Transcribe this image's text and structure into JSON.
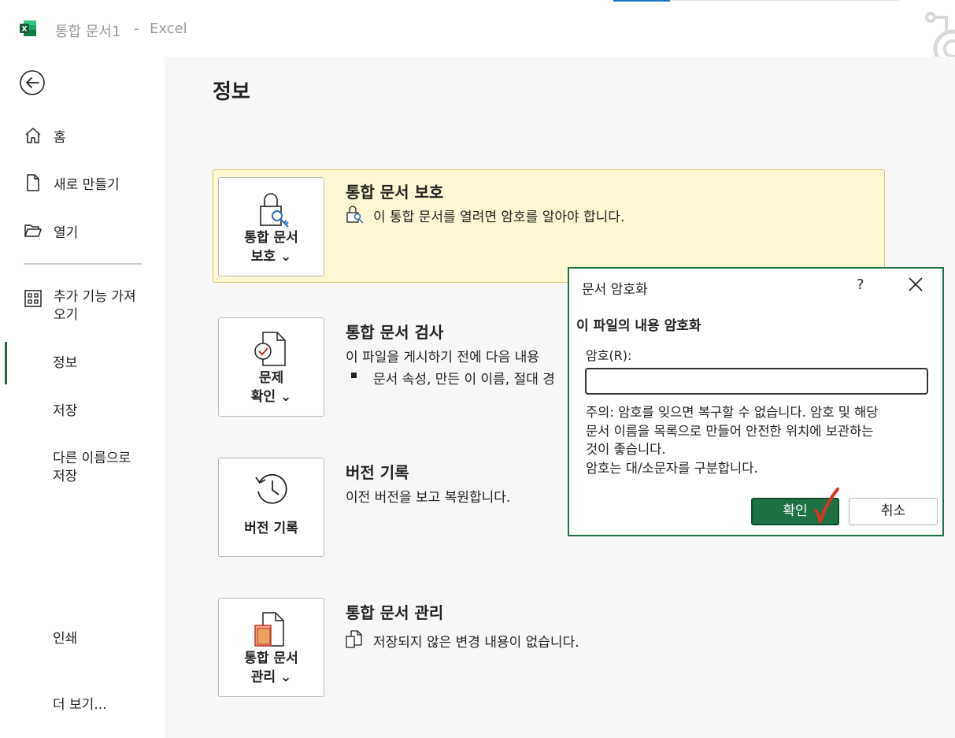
{
  "titlebar": {
    "document_name": "통합 문서1",
    "separator": "-",
    "app_name": "Excel",
    "logo_letter": "X",
    "logo_color": "#1e7145"
  },
  "sidebar": {
    "back_icon": "back-arrow-icon",
    "items": [
      {
        "label": "홈",
        "icon": "home-icon"
      },
      {
        "label": "새로 만들기",
        "icon": "new-document-icon"
      },
      {
        "label": "열기",
        "icon": "open-folder-icon"
      },
      {
        "label": "추가 기능 가져",
        "label2": "오기",
        "icon": "add-ins-icon"
      },
      {
        "label": "정보",
        "active": true
      },
      {
        "label": "저장"
      },
      {
        "label": "다른 이름으로",
        "label2": "저장"
      },
      {
        "label": "인쇄"
      },
      {
        "label": "더 보기..."
      }
    ]
  },
  "main": {
    "page_title": "정보",
    "sections": [
      {
        "button_line1": "통합 문서",
        "button_line2": "보호 ⌄",
        "title": "통합 문서 보호",
        "text": "이 통합 문서를 열려면 암호를 알아야 합니다."
      },
      {
        "button_line1": "문제",
        "button_line2": "확인 ⌄",
        "title": "통합 문서 검사",
        "text": "이 파일을 게시하기 전에 다음 내용",
        "bullet": "문서 속성, 만든 이 이름, 절대 경"
      },
      {
        "button_line1": "버전 기록",
        "title": "버전 기록",
        "text": "이전 버전을 보고 복원합니다."
      },
      {
        "button_line1": "통합 문서",
        "button_line2": "관리 ⌄",
        "title": "통합 문서 관리",
        "text": "저장되지 않은 변경 내용이 없습니다."
      }
    ]
  },
  "dialog": {
    "title": "문서 암호화",
    "help": "?",
    "heading": "이 파일의 내용 암호화",
    "password_label": "암호(R):",
    "password_value": "",
    "note_line1": "주의: 암호를 잊으면 복구할 수 없습니다. 암호 및 해당",
    "note_line2": "문서 이름을 목록으로 만들어 안전한 위치에 보관하는",
    "note_line3": "것이 좋습니다.",
    "note_line4": "암호는 대/소문자를 구분합니다.",
    "ok_label": "확인",
    "cancel_label": "취소",
    "accent_color": "#1e7145"
  }
}
